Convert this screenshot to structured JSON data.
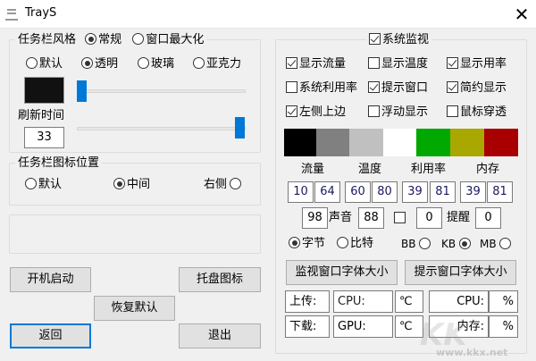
{
  "window": {
    "title": "TrayS",
    "close": "✕"
  },
  "taskbar_style": {
    "legend": "任务栏风格",
    "mode_options": [
      "常规",
      "窗口最大化"
    ],
    "mode_selected": 0,
    "style_options": [
      "默认",
      "透明",
      "玻璃",
      "亚克力"
    ],
    "style_selected": 1,
    "swatch_color": "#111111",
    "alpha_slider": 0.0,
    "refresh_label": "刷新时间",
    "refresh_value": "33",
    "refresh_slider": 1.0
  },
  "icon_position": {
    "legend": "任务栏图标位置",
    "options": [
      "默认",
      "中间",
      "右侧"
    ],
    "selected": 1
  },
  "buttons": {
    "startup": "开机启动",
    "tray_icon": "托盘图标",
    "restore": "恢复默认",
    "back": "返回",
    "exit": "退出"
  },
  "monitor": {
    "legend": "系统监视",
    "legend_checked": true,
    "checks": [
      {
        "label": "显示流量",
        "checked": true
      },
      {
        "label": "显示温度",
        "checked": false
      },
      {
        "label": "显示用率",
        "checked": true
      },
      {
        "label": "系统利用率",
        "checked": false
      },
      {
        "label": "提示窗口",
        "checked": true
      },
      {
        "label": "简约显示",
        "checked": true
      },
      {
        "label": "左侧上边",
        "checked": true
      },
      {
        "label": "浮动显示",
        "checked": false
      },
      {
        "label": "鼠标穿透",
        "checked": false
      }
    ],
    "colors": [
      "#000000",
      "#808080",
      "#c0c0c0",
      "#ffffff",
      "#00a800",
      "#a8a800",
      "#a80000"
    ],
    "headers": [
      "流量",
      "温度",
      "利用率",
      "内存"
    ],
    "values": [
      "10",
      "64",
      "60",
      "80",
      "39",
      "81",
      "39",
      "81"
    ],
    "sound_left": "98",
    "sound_label": "声音",
    "sound_right": "88",
    "remind_check": false,
    "remind_left": "0",
    "remind_label": "提醒",
    "remind_right": "0",
    "unit_options": [
      "字节",
      "比特"
    ],
    "unit_selected": 0,
    "size_options": [
      "BB",
      "KB",
      "MB"
    ],
    "size_selected": 1,
    "font_btn_monitor": "监视窗口字体大小",
    "font_btn_tip": "提示窗口字体大小",
    "upload": "上传:",
    "download": "下载:",
    "cpu": "CPU:",
    "gpu": "GPU:",
    "celsius": "℃",
    "celsius2": "℃",
    "cpu_r": "CPU:",
    "mem_r": "内存:",
    "pct": "%",
    "pct2": "%"
  },
  "watermark": "KK下载 www.kkx.net"
}
